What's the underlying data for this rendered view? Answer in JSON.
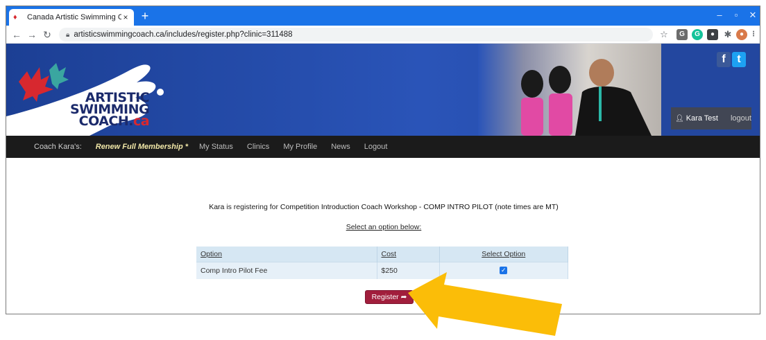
{
  "browser": {
    "tab_title": "Canada Artistic Swimming Coach",
    "tab_close": "×",
    "new_tab": "+",
    "url": "artisticswimmingcoach.ca/includes/register.php?clinic=311488",
    "accent": "#1a73e8"
  },
  "site": {
    "logo_line1": "ARTISTIC",
    "logo_line2": "SWIMMING",
    "logo_line3": "COACH.",
    "logo_ca": "ca",
    "social_facebook": "f",
    "social_twitter": "t",
    "user_name": "Kara Test",
    "logout_label": "logout"
  },
  "nav": {
    "lead": "Coach Kara's:",
    "renew": "Renew Full Membership *",
    "items": [
      "My Status",
      "Clinics",
      "My Profile",
      "News",
      "Logout"
    ]
  },
  "main": {
    "registrant": "Kara",
    "registering_text": "is registering for",
    "clinic_name": "Competition Introduction Coach Workshop - COMP INTRO PILOT (note times are MT)",
    "select_prompt": "Select an option below:",
    "table": {
      "headers": [
        "Option",
        "Cost",
        "Select Option"
      ],
      "rows": [
        {
          "option": "Comp Intro Pilot Fee",
          "cost": "$250",
          "selected": true
        }
      ]
    },
    "register_label": "Register"
  },
  "colors": {
    "header_blue": "#2a54b8",
    "nav_dark": "#1b1b1b",
    "register_red": "#a11e3c",
    "arrow_yellow": "#fbbd08"
  }
}
